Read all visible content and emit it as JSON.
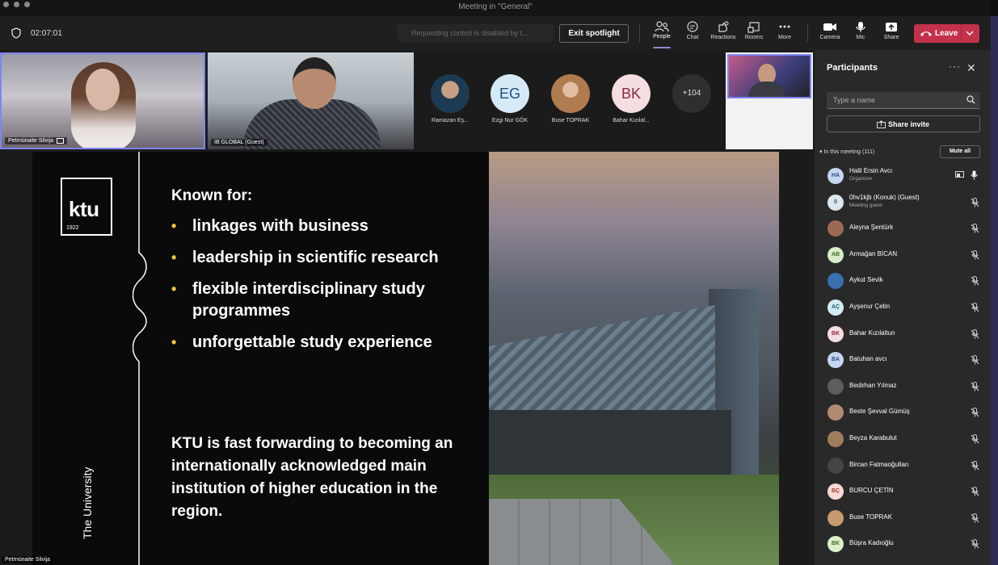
{
  "window": {
    "title": "Meeting in \"General\""
  },
  "toolbar": {
    "timer": "02:07:01",
    "control_notice": "Requesting control is disabled by t...",
    "exit_spotlight": "Exit spotlight",
    "buttons": [
      {
        "label": "People",
        "icon": "people-icon"
      },
      {
        "label": "Chat",
        "icon": "chat-icon"
      },
      {
        "label": "Reactions",
        "icon": "reactions-icon"
      },
      {
        "label": "Rooms",
        "icon": "rooms-icon"
      },
      {
        "label": "More",
        "icon": "more-icon"
      },
      {
        "label": "Camera",
        "icon": "camera-icon"
      },
      {
        "label": "Mic",
        "icon": "mic-icon"
      },
      {
        "label": "Share",
        "icon": "share-icon"
      }
    ],
    "leave": "Leave"
  },
  "videos": {
    "tile1_name": "Petrnünaite Silvija",
    "tile2_name": "IB GLOBAL (Guest)",
    "avatars": [
      {
        "initials": "",
        "name": "Ramazan Eş...",
        "color": "#1f5a7a"
      },
      {
        "initials": "EG",
        "name": "Ezgi Nur GÖK",
        "color": "#d6e9f7",
        "text": "#1f4e7a"
      },
      {
        "initials": "",
        "name": "Buse TOPRAK",
        "color": "#c79a72"
      },
      {
        "initials": "BK",
        "name": "Bahar Kızılal...",
        "color": "#f6dde2",
        "text": "#8a2b3f"
      }
    ],
    "overflow": "+104"
  },
  "slide": {
    "logo": "ktu",
    "logo_year": "1922",
    "rail_text": "The University",
    "heading": "Known for:",
    "bullets": [
      "linkages with business",
      "leadership in scientific research",
      "flexible interdisciplinary study programmes",
      "unforgettable study experience"
    ],
    "claim": "KTU is fast forwarding to becoming an internationally acknowledged main institution of higher education in the region.",
    "presenter": "Petrnünaite Silvija"
  },
  "participants": {
    "title": "Participants",
    "search_placeholder": "Type a name",
    "share_invite": "Share invite",
    "in_meeting": "In this meeting (111)",
    "mute_all": "Mute all",
    "people": [
      {
        "initials": "HA",
        "name": "Halil Ersin Avcı",
        "role": "Organizer",
        "bg": "#c6d6f1",
        "fg": "#2c4f8a",
        "mic": "on"
      },
      {
        "initials": "0",
        "name": "0hv1kjb (Konuk) (Guest)",
        "role": "Meeting guest",
        "bg": "#dde6ec",
        "fg": "#3a4a56",
        "mic": "off"
      },
      {
        "initials": "",
        "name": "Aleyna Şentürk",
        "role": "",
        "bg": "#9a6b52",
        "fg": "#fff",
        "mic": "off"
      },
      {
        "initials": "AB",
        "name": "Armağan BİCAN",
        "role": "",
        "bg": "#d9ecc9",
        "fg": "#3f6a2a",
        "mic": "off"
      },
      {
        "initials": "",
        "name": "Aykut Sevik",
        "role": "",
        "bg": "#3a6fb0",
        "fg": "#fff",
        "mic": "off"
      },
      {
        "initials": "AÇ",
        "name": "Ayşenur Çetin",
        "role": "",
        "bg": "#d1ecf3",
        "fg": "#1f6079",
        "mic": "off"
      },
      {
        "initials": "BK",
        "name": "Bahar Kızılaltun",
        "role": "",
        "bg": "#f6dde2",
        "fg": "#8a2b3f",
        "mic": "off"
      },
      {
        "initials": "BA",
        "name": "Batuhan avcı",
        "role": "",
        "bg": "#c6d6f1",
        "fg": "#2c4f8a",
        "mic": "off"
      },
      {
        "initials": "",
        "name": "Bedirhan Yılmaz",
        "role": "",
        "bg": "#5d5d5d",
        "fg": "#fff",
        "mic": "off"
      },
      {
        "initials": "",
        "name": "Beste Şevval Gümüş",
        "role": "",
        "bg": "#b28a74",
        "fg": "#fff",
        "mic": "off"
      },
      {
        "initials": "",
        "name": "Beyza Karabulut",
        "role": "",
        "bg": "#a07d5c",
        "fg": "#fff",
        "mic": "off"
      },
      {
        "initials": "",
        "name": "Bircan Fatmaoğulları",
        "role": "",
        "bg": "#444",
        "fg": "#fff",
        "mic": "off"
      },
      {
        "initials": "BÇ",
        "name": "BURCU ÇETİN",
        "role": "",
        "bg": "#f8d9d5",
        "fg": "#9a3b2f",
        "mic": "off"
      },
      {
        "initials": "",
        "name": "Buse TOPRAK",
        "role": "",
        "bg": "#c79a72",
        "fg": "#fff",
        "mic": "off"
      },
      {
        "initials": "BK",
        "name": "Büşra Kadıoğlu",
        "role": "",
        "bg": "#dcefc9",
        "fg": "#3f6a2a",
        "mic": "off"
      }
    ]
  }
}
